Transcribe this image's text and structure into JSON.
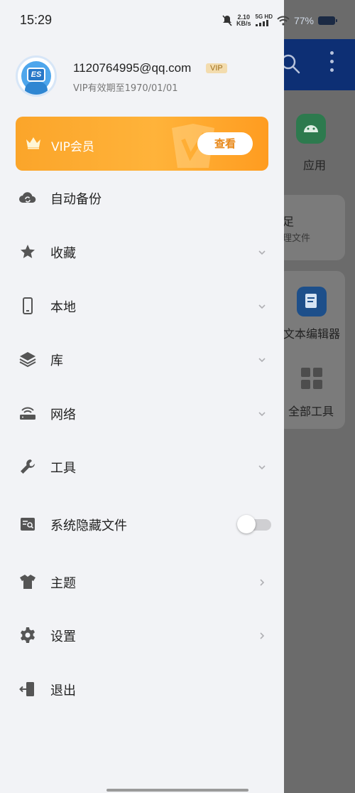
{
  "status_bar": {
    "time": "15:29",
    "net_speed_value": "2.10",
    "net_speed_unit": "KB/s",
    "signal_label": "5G HD",
    "battery": "77%"
  },
  "background": {
    "app_label": "应用",
    "card_title": "足",
    "card_sub": "理文件",
    "text_editor_label": "文本编辑器",
    "all_tools_label": "全部工具"
  },
  "profile": {
    "avatar_text": "ES",
    "email": "1120764995@qq.com",
    "vip_tag": "VIP",
    "vip_expire": "VIP有效期至1970/01/01"
  },
  "vip_banner": {
    "label": "VIP会员",
    "button": "查看"
  },
  "menu": [
    {
      "label": "自动备份"
    },
    {
      "label": "收藏"
    },
    {
      "label": "本地"
    },
    {
      "label": "库"
    },
    {
      "label": "网络"
    },
    {
      "label": "工具"
    },
    {
      "label": "系统隐藏文件",
      "toggle_on": false
    },
    {
      "label": "主题"
    },
    {
      "label": "设置"
    },
    {
      "label": "退出"
    }
  ]
}
